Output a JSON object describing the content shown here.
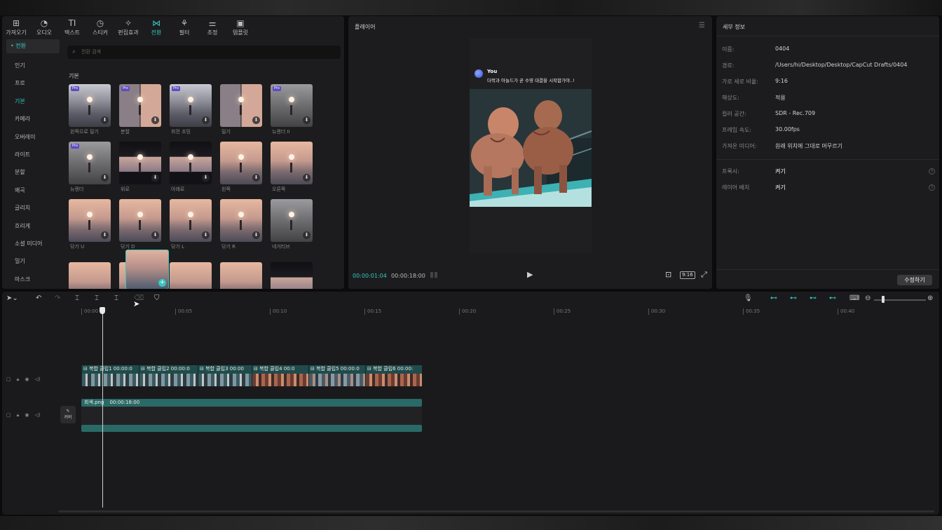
{
  "toolbar": {
    "items": [
      {
        "label": "가져오기",
        "icon": "import-icon"
      },
      {
        "label": "오디오",
        "icon": "audio-icon"
      },
      {
        "label": "텍스트",
        "icon": "text-icon"
      },
      {
        "label": "스티커",
        "icon": "sticker-icon"
      },
      {
        "label": "편집효과",
        "icon": "effects-icon"
      },
      {
        "label": "전환",
        "icon": "transition-icon"
      },
      {
        "label": "필터",
        "icon": "filter-icon"
      },
      {
        "label": "조정",
        "icon": "adjust-icon"
      },
      {
        "label": "템플릿",
        "icon": "template-icon"
      }
    ],
    "active_index": 5
  },
  "sidebar": {
    "header": "• 전환",
    "items": [
      "인기",
      "프로",
      "기본",
      "카메라",
      "오버레이",
      "라이트",
      "분할",
      "왜곡",
      "글리치",
      "흐리게",
      "소셜 미디어",
      "밀기",
      "마스크"
    ],
    "current": "기본"
  },
  "search": {
    "placeholder": "전환 검색"
  },
  "section": {
    "title": "기본"
  },
  "thumbnails": [
    {
      "label": "왼쪽으로 밀기",
      "pro": true,
      "style": "city"
    },
    {
      "label": "분할",
      "pro": true,
      "style": "split"
    },
    {
      "label": "회전 조밍",
      "pro": true,
      "style": "city"
    },
    {
      "label": "밀기",
      "pro": false,
      "style": "split"
    },
    {
      "label": "뉴렌더 II",
      "pro": true,
      "style": "grey"
    },
    {
      "label": "뉴렌더",
      "pro": true,
      "style": "grey"
    },
    {
      "label": "위로",
      "pro": false,
      "style": "dark"
    },
    {
      "label": "아래로",
      "pro": false,
      "style": "dark"
    },
    {
      "label": "왼쪽",
      "pro": false,
      "style": "sunset"
    },
    {
      "label": "오른쪽",
      "pro": false,
      "style": "sunset"
    },
    {
      "label": "닦기 U",
      "pro": false,
      "style": "sunset"
    },
    {
      "label": "닦기 D",
      "pro": false,
      "style": "sunset"
    },
    {
      "label": "닦기 L",
      "pro": false,
      "style": "sunset"
    },
    {
      "label": "닦기 R",
      "pro": false,
      "style": "sunset"
    },
    {
      "label": "네거티브",
      "pro": false,
      "style": "grey"
    }
  ],
  "pro_badge": "Pro",
  "player": {
    "title": "플레이어",
    "chat_user": "You",
    "chat_message": "더락과 아놀드가 곧 수영 대결을 시작합가야..!",
    "time_current": "00:00:01:04",
    "time_total": "00:00:18:00",
    "ratio": "9:16"
  },
  "details": {
    "title": "세부 정보",
    "rows": [
      {
        "key": "이름:",
        "value": "0404"
      },
      {
        "key": "경로:",
        "value": "/Users/hi/Desktop/Desktop/CapCut Drafts/0404"
      },
      {
        "key": "가로 세로 비율:",
        "value": "9:16"
      },
      {
        "key": "해상도:",
        "value": "적용"
      },
      {
        "key": "컬러 공간:",
        "value": "SDR - Rec.709"
      },
      {
        "key": "프레임 속도:",
        "value": "30.00fps"
      },
      {
        "key": "가져온 미디어:",
        "value": "원래 위치에 그대로 머무르기"
      }
    ],
    "extra_rows": [
      {
        "key": "프록시:",
        "value": "켜기"
      },
      {
        "key": "레이어 배치",
        "value": "켜기"
      }
    ],
    "modify_button": "수정하기"
  },
  "timeline": {
    "ruler": [
      "00:00",
      "00:05",
      "00:10",
      "00:15",
      "00:20",
      "00:25",
      "00:30",
      "00:35",
      "00:40"
    ],
    "clips": [
      {
        "label": "복합 클립1",
        "time": "00:00:0"
      },
      {
        "label": "복합 클립2",
        "time": "00:00:0"
      },
      {
        "label": "복합 클립3",
        "time": "00:00"
      },
      {
        "label": "복합 클립4",
        "time": "00:0"
      },
      {
        "label": "복합 클립5",
        "time": "00:00:0"
      },
      {
        "label": "복합 클립6",
        "time": "00:00:"
      }
    ],
    "overlay_name": "회색.png",
    "overlay_duration": "00:00:18:00",
    "cover_label": "커버"
  },
  "colors": {
    "accent": "#35c8c0",
    "clip": "#1f4c4b",
    "overlay": "#2a6a66"
  }
}
